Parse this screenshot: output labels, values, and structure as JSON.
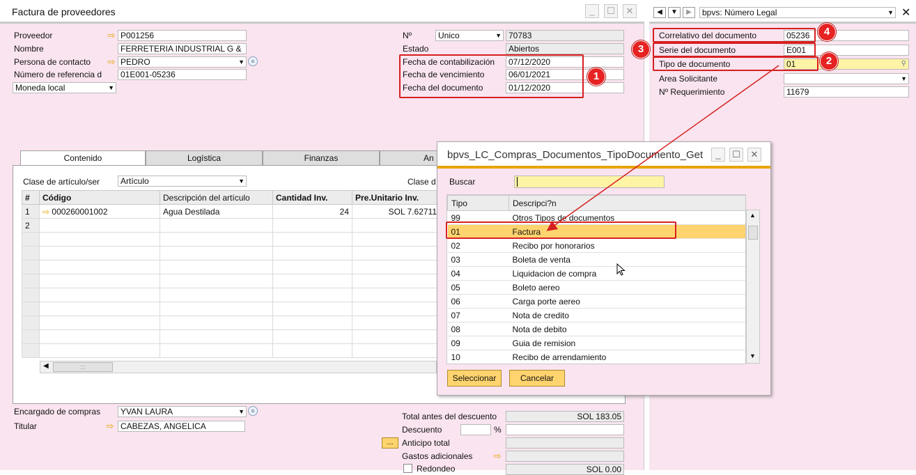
{
  "main": {
    "title": "Factura de proveedores",
    "proveedor": {
      "label": "Proveedor",
      "value": "P001256"
    },
    "nombre": {
      "label": "Nombre",
      "value": "FERRETERIA INDUSTRIAL G &"
    },
    "contacto": {
      "label": "Persona de contacto",
      "value": "PEDRO"
    },
    "referencia": {
      "label": "Número de referencia d",
      "value": "01E001-05236"
    },
    "moneda": {
      "value": "Moneda local"
    },
    "numero": {
      "label": "Nº",
      "series": "Unico",
      "value": "70783"
    },
    "estado": {
      "label": "Estado",
      "value": "Abiertos"
    },
    "fecha_contab": {
      "label": "Fecha de contabilización",
      "value": "07/12/2020"
    },
    "fecha_venc": {
      "label": "Fecha de vencimiento",
      "value": "06/01/2021"
    },
    "fecha_doc": {
      "label": "Fecha del documento",
      "value": "01/12/2020"
    },
    "tabs": [
      "Contenido",
      "Logística",
      "Finanzas",
      "An"
    ],
    "clase_articulo": {
      "label": "Clase de artículo/ser",
      "value": "Artículo"
    },
    "clase_cut": "Clase d",
    "grid": {
      "headers": [
        "#",
        "Código",
        "Descripción del artículo",
        "Cantidad Inv.",
        "Pre.Unitario Inv."
      ],
      "rows": [
        {
          "n": "1",
          "codigo": "000260001002",
          "desc": "Agua Destilada",
          "cant": "24",
          "precio": "SOL 7.62711"
        },
        {
          "n": "2",
          "codigo": "",
          "desc": "",
          "cant": "",
          "precio": ""
        }
      ],
      "scroll_grip": ":::"
    },
    "encargado": {
      "label": "Encargado de compras",
      "value": "YVAN LAURA"
    },
    "titular": {
      "label": "Titular",
      "value": "CABEZAS, ANGELICA"
    },
    "totals": {
      "antes_desc": {
        "label": "Total antes del descuento",
        "value": "SOL 183.05"
      },
      "descuento": {
        "label": "Descuento",
        "pct": "%"
      },
      "anticipo": {
        "label": "Anticipo total",
        "button": "..."
      },
      "gastos": {
        "label": "Gastos adicionales"
      },
      "redondeo": {
        "label": "Redondeo",
        "value": "SOL 0.00"
      }
    }
  },
  "right": {
    "nav_title": "bpvs: Número Legal",
    "correlativo": {
      "label": "Correlativo del documento",
      "value": "05236"
    },
    "serie": {
      "label": "Serie del documento",
      "value": "E001"
    },
    "tipo": {
      "label": "Tipo de documento",
      "value": "01"
    },
    "area": {
      "label": "Area Solicitante",
      "value": ""
    },
    "requerimiento": {
      "label": "Nº Requerimiento",
      "value": "11679"
    }
  },
  "dialog": {
    "title": "bpvs_LC_Compras_Documentos_TipoDocumento_Get",
    "search_label": "Buscar",
    "columns": [
      "Tipo",
      "Descripci?n"
    ],
    "rows": [
      {
        "tipo": "99",
        "desc": "Otros Tipos de documentos"
      },
      {
        "tipo": "01",
        "desc": "Factura"
      },
      {
        "tipo": "02",
        "desc": "Recibo por honorarios"
      },
      {
        "tipo": "03",
        "desc": "Boleta de venta"
      },
      {
        "tipo": "04",
        "desc": "Liquidacion de compra"
      },
      {
        "tipo": "05",
        "desc": "Boleto aereo"
      },
      {
        "tipo": "06",
        "desc": "Carga porte aereo"
      },
      {
        "tipo": "07",
        "desc": "Nota de credito"
      },
      {
        "tipo": "08",
        "desc": "Nota de debito"
      },
      {
        "tipo": "09",
        "desc": "Guia de remision"
      },
      {
        "tipo": "10",
        "desc": "Recibo de arrendamiento"
      }
    ],
    "select_btn": "Seleccionar",
    "cancel_btn": "Cancelar"
  },
  "badges": [
    "1",
    "2",
    "3",
    "4"
  ],
  "colors": {
    "accent": "#e9a400",
    "annotation_red": "#d62020",
    "selection": "#ffd46e",
    "panel": "#f9e4ef"
  }
}
